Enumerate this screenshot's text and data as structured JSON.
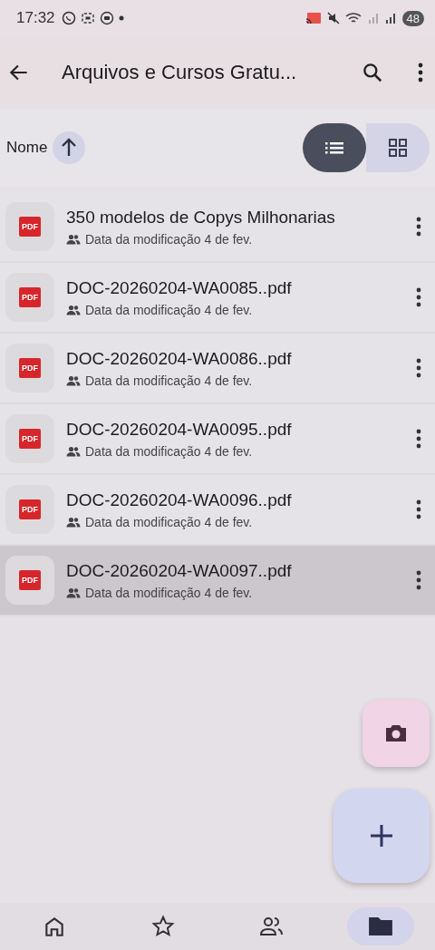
{
  "status_bar": {
    "time": "17:32",
    "battery": "48"
  },
  "app_bar": {
    "title": "Arquivos e Cursos Gratu..."
  },
  "sort": {
    "label": "Nome"
  },
  "view_toggle": [
    {
      "kind": "list",
      "selected": true
    },
    {
      "kind": "grid",
      "selected": false
    }
  ],
  "files": [
    {
      "icon_label": "PDF",
      "name": "350 modelos de Copys Milhonarias",
      "meta": "Data da modificação 4 de fev.",
      "selected": false
    },
    {
      "icon_label": "PDF",
      "name": "DOC-20260204-WA0085..pdf",
      "meta": "Data da modificação 4 de fev.",
      "selected": false
    },
    {
      "icon_label": "PDF",
      "name": "DOC-20260204-WA0086..pdf",
      "meta": "Data da modificação 4 de fev.",
      "selected": false
    },
    {
      "icon_label": "PDF",
      "name": "DOC-20260204-WA0095..pdf",
      "meta": "Data da modificação 4 de fev.",
      "selected": false
    },
    {
      "icon_label": "PDF",
      "name": "DOC-20260204-WA0096..pdf",
      "meta": "Data da modificação 4 de fev.",
      "selected": false
    },
    {
      "icon_label": "PDF",
      "name": "DOC-20260204-WA0097..pdf",
      "meta": "Data da modificação 4 de fev.",
      "selected": true
    }
  ],
  "bottom_nav": [
    {
      "kind": "home",
      "selected": false
    },
    {
      "kind": "starred",
      "selected": false
    },
    {
      "kind": "shared",
      "selected": false
    },
    {
      "kind": "files",
      "selected": true
    }
  ]
}
